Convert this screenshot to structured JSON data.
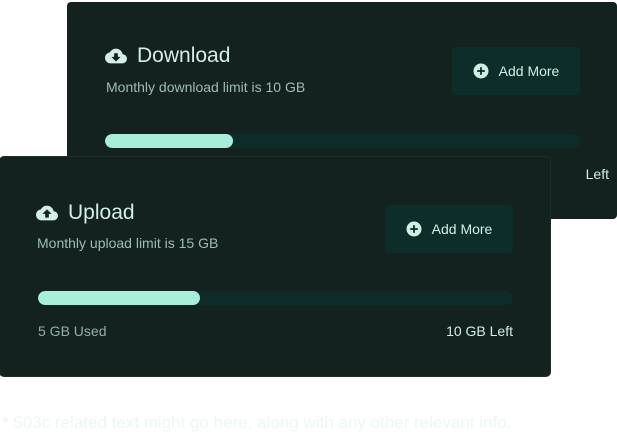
{
  "download": {
    "title": "Download",
    "subtitle": "Monthly download limit is 10 GB",
    "add_more_label": "Add More",
    "progress_fraction": 0.27,
    "left_label": "Left",
    "icon": "cloud-download-icon"
  },
  "upload": {
    "title": "Upload",
    "subtitle": "Monthly upload limit is 15 GB",
    "add_more_label": "Add More",
    "progress_fraction": 0.34,
    "used_label": "5 GB Used",
    "left_label": "10 GB Left",
    "icon": "cloud-upload-icon"
  },
  "footnote": "* 503c related text might go here, along with any other relevant info.",
  "colors": {
    "card_bg": "#13211f",
    "button_bg": "#0d2d2a",
    "track_bg": "#0d2b28",
    "progress_fill": "#a7eedb",
    "heading_text": "#d3eee6",
    "muted_text": "#9fbcb4"
  }
}
